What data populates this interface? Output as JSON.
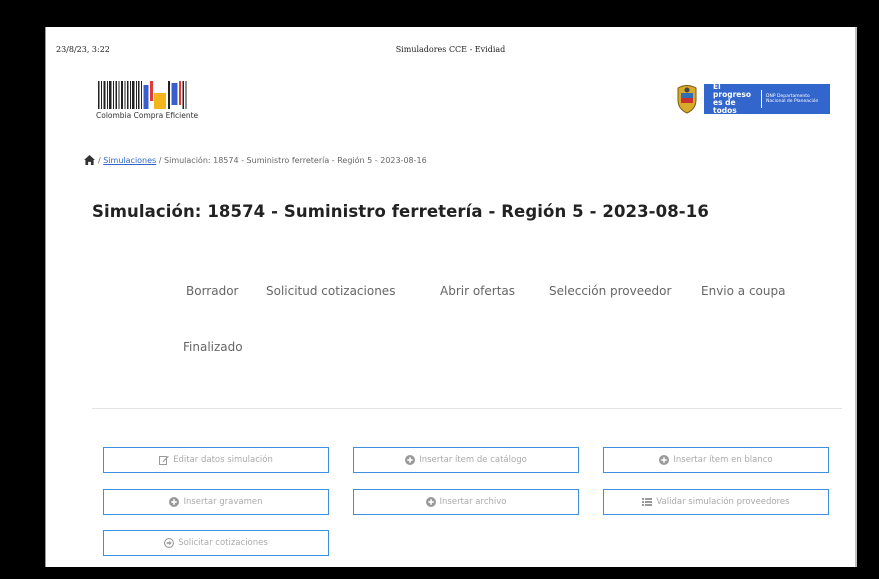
{
  "print_header": {
    "date": "23/8/23, 3:22",
    "title": "Simuladores CCE - Evidiad"
  },
  "logo": {
    "text": "Colombia Compra Eficiente"
  },
  "gov_banner": {
    "main": "El progreso es de todos",
    "sub": "DNP Departamento Nacional de Planeación",
    "color": "#3366cc"
  },
  "breadcrumb": {
    "home_icon": "home-icon",
    "separator": "/",
    "link": "Simulaciones",
    "current": "Simulación: 18574 - Suministro ferretería - Región 5 - 2023-08-16"
  },
  "title": "Simulación: 18574 - Suministro ferretería - Región 5 - 2023-08-16",
  "steps": [
    "Borrador",
    "Solicitud cotizaciones",
    "Abrir ofertas",
    "Selección proveedor",
    "Envio a coupa",
    "Finalizado"
  ],
  "actions": [
    {
      "icon": "edit-icon",
      "label": "Editar datos simulación"
    },
    {
      "icon": "plus-circle-icon",
      "label": "Insertar ítem de catálogo"
    },
    {
      "icon": "plus-circle-icon",
      "label": "Insertar ítem en blanco"
    },
    {
      "icon": "plus-circle-icon",
      "label": "Insertar gravamen"
    },
    {
      "icon": "plus-circle-icon",
      "label": "Insertar archivo"
    },
    {
      "icon": "list-icon",
      "label": "Validar simulación proveedores"
    },
    {
      "icon": "arrow-circle-icon",
      "label": "Solicitar cotizaciones"
    }
  ],
  "colors": {
    "button_border": "#3d8fe0",
    "link": "#3366cc"
  }
}
